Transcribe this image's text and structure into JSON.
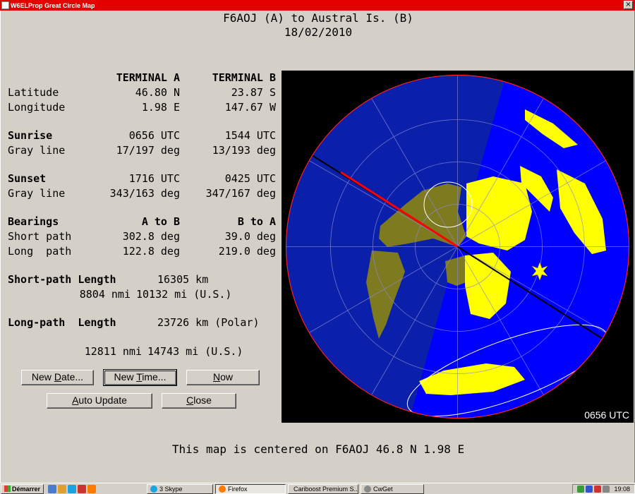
{
  "window": {
    "title": "W6ELProp Great Circle Map",
    "close_glyph": "×"
  },
  "header": {
    "line1": "F6AOJ (A) to Austral Is. (B)",
    "line2": "18/02/2010"
  },
  "terminals": {
    "col_a": "TERMINAL A",
    "col_b": "TERMINAL B"
  },
  "latitude": {
    "label": "Latitude",
    "a": "46.80 N",
    "b": "23.87 S"
  },
  "longitude": {
    "label": "Longitude",
    "a": "1.98 E",
    "b": "147.67 W"
  },
  "sunrise": {
    "label": "Sunrise",
    "a": "0656 UTC",
    "b": "1544 UTC",
    "gray_label": "Gray line",
    "gray_a": "17/197 deg",
    "gray_b": "13/193 deg"
  },
  "sunset": {
    "label": "Sunset",
    "a": "1716 UTC",
    "b": "0425 UTC",
    "gray_label": "Gray line",
    "gray_a": "343/163 deg",
    "gray_b": "347/167 deg"
  },
  "bearings": {
    "label": "Bearings",
    "a_to_b": "A to B",
    "b_to_a": "B to A",
    "short_label": "Short path",
    "short_a": "302.8 deg",
    "short_b": "39.0 deg",
    "long_label": "Long  path",
    "long_a": "122.8 deg",
    "long_b": "219.0 deg"
  },
  "short_path_length": {
    "label": "Short-path Length",
    "km": "16305 km",
    "nmi": "8804 nmi",
    "mi": "10132 mi (U.S.)"
  },
  "long_path_length": {
    "label": "Long-path  Length",
    "km": "23726 km (Polar)",
    "nmi": "12811 nmi",
    "mi": "14743 mi (U.S.)"
  },
  "buttons": {
    "new_date": {
      "pre": "New ",
      "u": "D",
      "post": "ate..."
    },
    "new_time": {
      "pre": "New ",
      "u": "T",
      "post": "ime..."
    },
    "now": {
      "pre": "",
      "u": "N",
      "post": "ow"
    },
    "auto_update": {
      "pre": "",
      "u": "A",
      "post": "uto Update"
    },
    "close": {
      "pre": "",
      "u": "C",
      "post": "lose"
    }
  },
  "map": {
    "time": "0656 UTC",
    "colors": {
      "ocean_night": "#0a1faa",
      "ocean_day": "#0000ff",
      "land_night": "#7d7a20",
      "land_day": "#ffff00",
      "path": "#ff0000"
    }
  },
  "footer": "This map is centered on F6AOJ 46.8 N 1.98 E",
  "taskbar": {
    "start": "Démarrer",
    "tasks": [
      {
        "label": "3 Skype",
        "icon_color": "#1aa3e0"
      },
      {
        "label": "Firefox",
        "icon_color": "#ff7a00"
      },
      {
        "label": "Cariboost Premium S...",
        "icon_color": "#cc2222"
      },
      {
        "label": "CwGet",
        "icon_color": "#888888"
      }
    ],
    "clock": "19:08"
  }
}
